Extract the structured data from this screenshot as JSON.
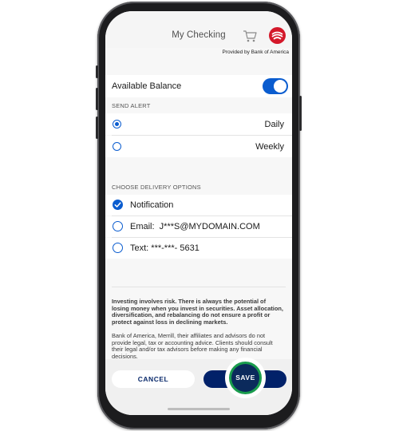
{
  "header": {
    "title": "My Checking",
    "provided_by": "Provided by Bank of America",
    "cart_icon": "cart-icon",
    "logo_icon": "bank-logo-icon"
  },
  "balance": {
    "label": "Available Balance",
    "toggle_on": true
  },
  "send_alert": {
    "section_label": "SEND ALERT",
    "options": [
      {
        "label": "Daily",
        "selected": true
      },
      {
        "label": "Weekly",
        "selected": false
      }
    ]
  },
  "delivery": {
    "section_label": "CHOOSE DELIVERY OPTIONS",
    "options": [
      {
        "label": "Notification",
        "checked": true
      },
      {
        "label": "Email:  J***S@MYDOMAIN.COM",
        "checked": false
      },
      {
        "label": "Text: ***-***- 5631",
        "checked": false
      }
    ]
  },
  "disclaimer": {
    "bold": "Investing involves risk. There is always the potential of losing money when you invest in securities. Asset allocation, diversification, and rebalancing do not ensure a profit or protect against loss in declining markets.",
    "normal": "Bank of America, Merrill, their affiliates and advisors do not provide legal, tax or accounting advice. Clients should consult their legal and/or tax advisors before making any financial decisions."
  },
  "buttons": {
    "cancel": "CANCEL",
    "save": "SAVE"
  },
  "colors": {
    "accent": "#0a5ccf",
    "save_button": "#012169",
    "highlight_ring": "#1a9c4d",
    "brand": "#d4182a"
  }
}
